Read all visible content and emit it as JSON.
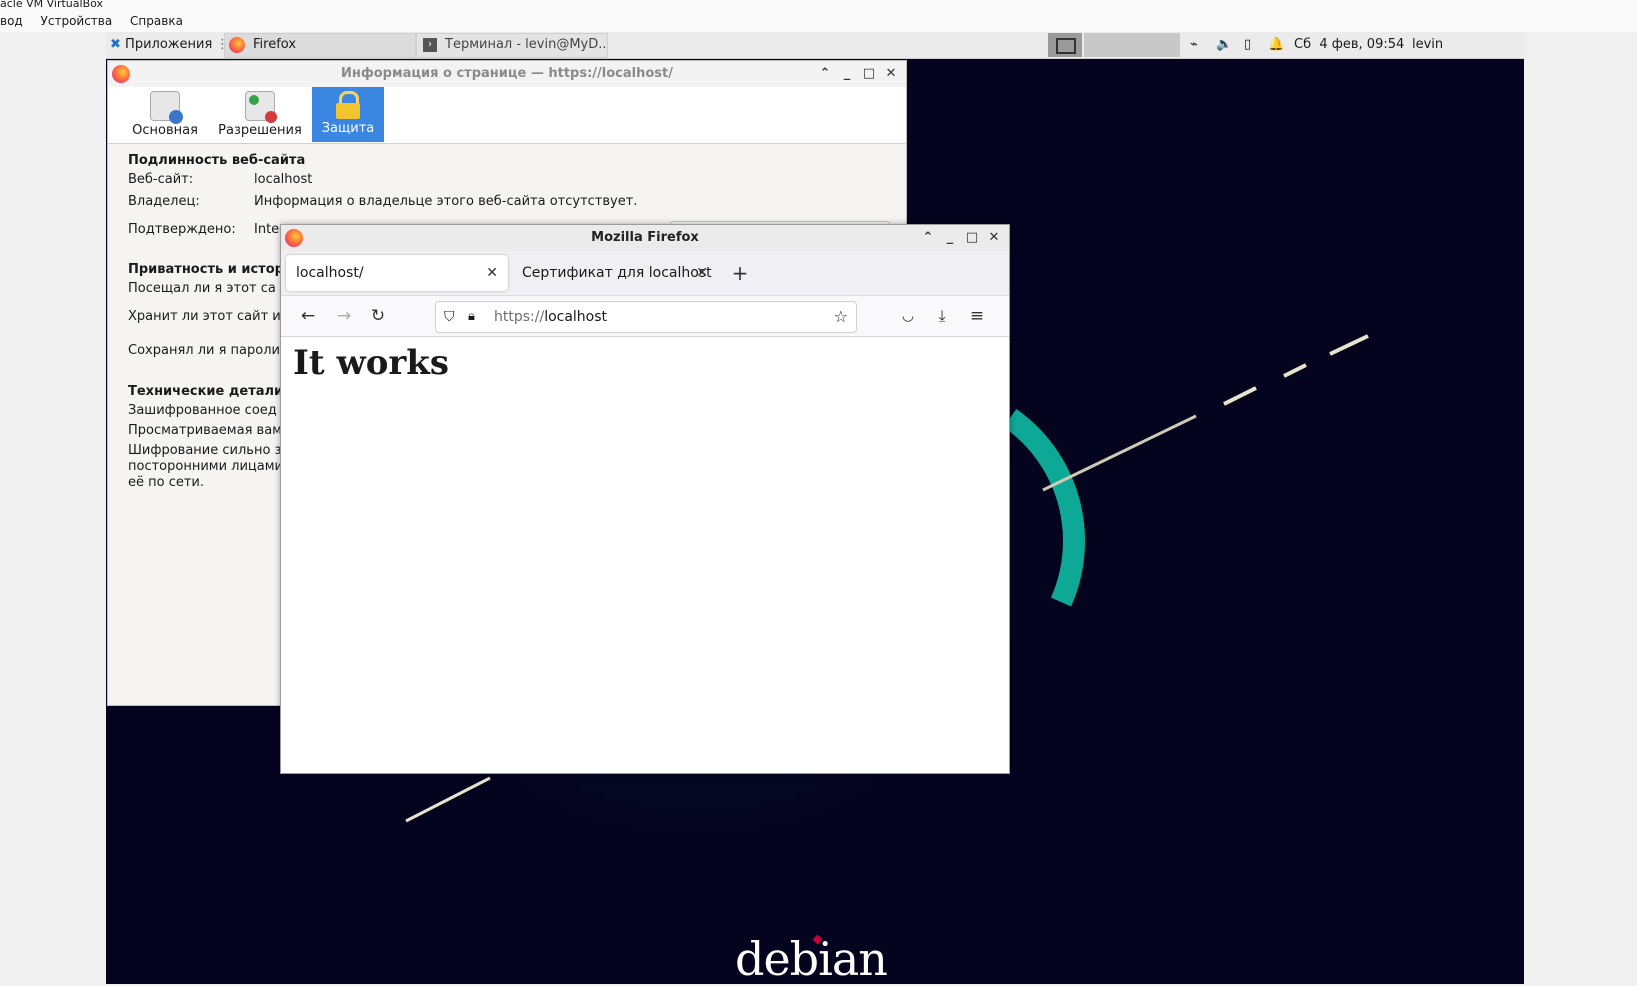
{
  "host": {
    "window_title": "acle VM VirtualBox",
    "menu": [
      "вод",
      "Устройства",
      "Справка"
    ]
  },
  "panel": {
    "apps_label": "Приложения",
    "tasks": [
      "Firefox",
      "Терминал - levin@MyD..."
    ],
    "clock": "Сб  4 фев, 09:54",
    "user": "levin"
  },
  "pageinfo": {
    "title": "Информация о странице — https://localhost/",
    "tabs": [
      {
        "label": "Основная",
        "icon": "info-doc-icon"
      },
      {
        "label": "Разрешения",
        "icon": "permissions-icon"
      },
      {
        "label": "Защита",
        "icon": "lock-icon",
        "selected": true
      }
    ],
    "identity_heading": "Подлинность веб-сайта",
    "website_label": "Веб-сайт:",
    "website_value": "localhost",
    "owner_label": "Владелец:",
    "owner_value": "Информация о владельце этого веб-сайта отсутствует.",
    "verified_label": "Подтверждено:",
    "verified_value": "Inte",
    "privacy_heading": "Приватность и истор",
    "privacy_rows": [
      "Посещал ли я этот са",
      "Хранит ли этот сайт и",
      "Сохранял ли я пароли"
    ],
    "tech_heading": "Технические детали",
    "tech_rows": [
      "Зашифрованное соед",
      "Просматриваемая вам",
      "Шифрование сильно з",
      "посторонними лицами",
      "её по сети."
    ]
  },
  "firefox": {
    "title": "Mozilla Firefox",
    "tabs": [
      {
        "label": "localhost/",
        "active": true
      },
      {
        "label": "Сертификат для localhost",
        "active": false
      }
    ],
    "new_tab": "+",
    "url_scheme": "https://",
    "url_host": "localhost",
    "page_heading": "It works"
  },
  "wallpaper": {
    "brand": "debian"
  }
}
